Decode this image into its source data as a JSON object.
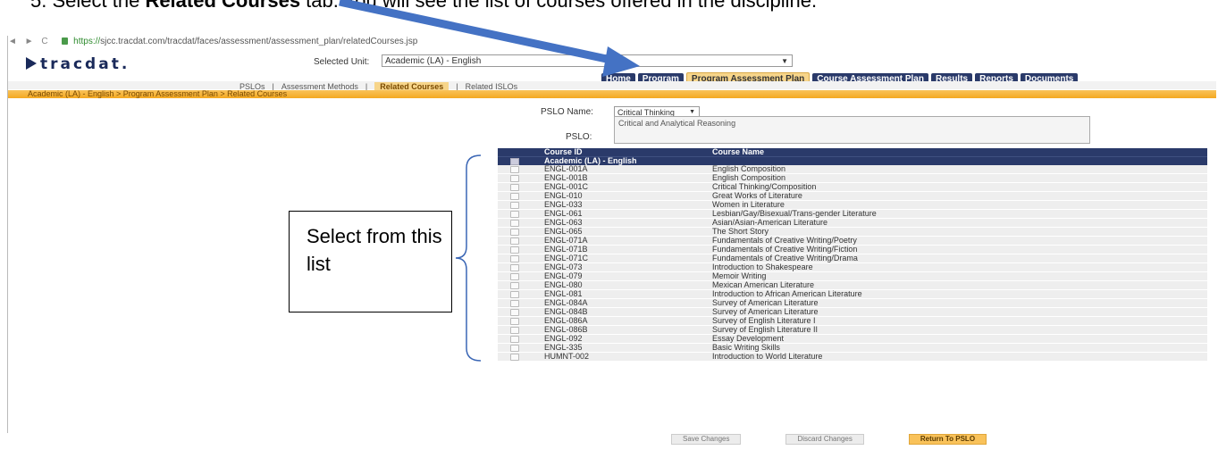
{
  "instruction": {
    "step": "5.",
    "pre": "Select the ",
    "bold": "Related Courses",
    "post": " tab. You will see the list of courses offered in the discipline."
  },
  "browser": {
    "url_scheme": "https://",
    "url_rest": "sjcc.tracdat.com/tracdat/faces/assessment/assessment_plan/relatedCourses.jsp"
  },
  "app": {
    "logo_text": "tracdat.",
    "selected_unit_label": "Selected Unit:",
    "selected_unit_value": "Academic (LA) - English"
  },
  "tabs": [
    "Home",
    "Program",
    "Program Assessment Plan",
    "Course Assessment Plan",
    "Results",
    "Reports",
    "Documents"
  ],
  "active_tab": "Program Assessment Plan",
  "subtabs": [
    "PSLOs",
    "Assessment Methods",
    "Related Courses",
    "Related ISLOs"
  ],
  "active_subtab": "Related Courses",
  "breadcrumb": "Academic (LA) - English > Program Assessment Plan > Related Courses",
  "form": {
    "pslo_name_label": "PSLO Name:",
    "pslo_name_value": "Critical Thinking",
    "pslo_label": "PSLO:",
    "pslo_value": "Critical and Analytical Reasoning"
  },
  "grid": {
    "col_course_id": "Course ID",
    "col_course_name": "Course Name",
    "group": "Academic (LA) - English",
    "rows": [
      {
        "id": "ENGL-001A",
        "name": "English Composition"
      },
      {
        "id": "ENGL-001B",
        "name": "English Composition"
      },
      {
        "id": "ENGL-001C",
        "name": "Critical Thinking/Composition"
      },
      {
        "id": "ENGL-010",
        "name": "Great Works of Literature"
      },
      {
        "id": "ENGL-033",
        "name": "Women in Literature"
      },
      {
        "id": "ENGL-061",
        "name": "Lesbian/Gay/Bisexual/Trans-gender Literature"
      },
      {
        "id": "ENGL-063",
        "name": "Asian/Asian-American Literature"
      },
      {
        "id": "ENGL-065",
        "name": "The Short Story"
      },
      {
        "id": "ENGL-071A",
        "name": "Fundamentals of Creative Writing/Poetry"
      },
      {
        "id": "ENGL-071B",
        "name": "Fundamentals of Creative Writing/Fiction"
      },
      {
        "id": "ENGL-071C",
        "name": "Fundamentals of Creative Writing/Drama"
      },
      {
        "id": "ENGL-073",
        "name": "Introduction to Shakespeare"
      },
      {
        "id": "ENGL-079",
        "name": "Memoir Writing"
      },
      {
        "id": "ENGL-080",
        "name": "Mexican American Literature"
      },
      {
        "id": "ENGL-081",
        "name": "Introduction to African American Literature"
      },
      {
        "id": "ENGL-084A",
        "name": "Survey of American Literature"
      },
      {
        "id": "ENGL-084B",
        "name": "Survey of American Literature"
      },
      {
        "id": "ENGL-086A",
        "name": "Survey of English Literature I"
      },
      {
        "id": "ENGL-086B",
        "name": "Survey of English Literature II"
      },
      {
        "id": "ENGL-092",
        "name": "Essay Development"
      },
      {
        "id": "ENGL-335",
        "name": "Basic Writing Skills"
      },
      {
        "id": "HUMNT-002",
        "name": "Introduction to World Literature"
      }
    ]
  },
  "buttons": {
    "save": "Save Changes",
    "discard": "Discard Changes",
    "return": "Return To PSLO"
  },
  "callout": "Select from this list",
  "colors": {
    "nav_dark": "#2a3a6a",
    "accent_orange": "#f4a921",
    "arrow_blue": "#4472c4"
  }
}
